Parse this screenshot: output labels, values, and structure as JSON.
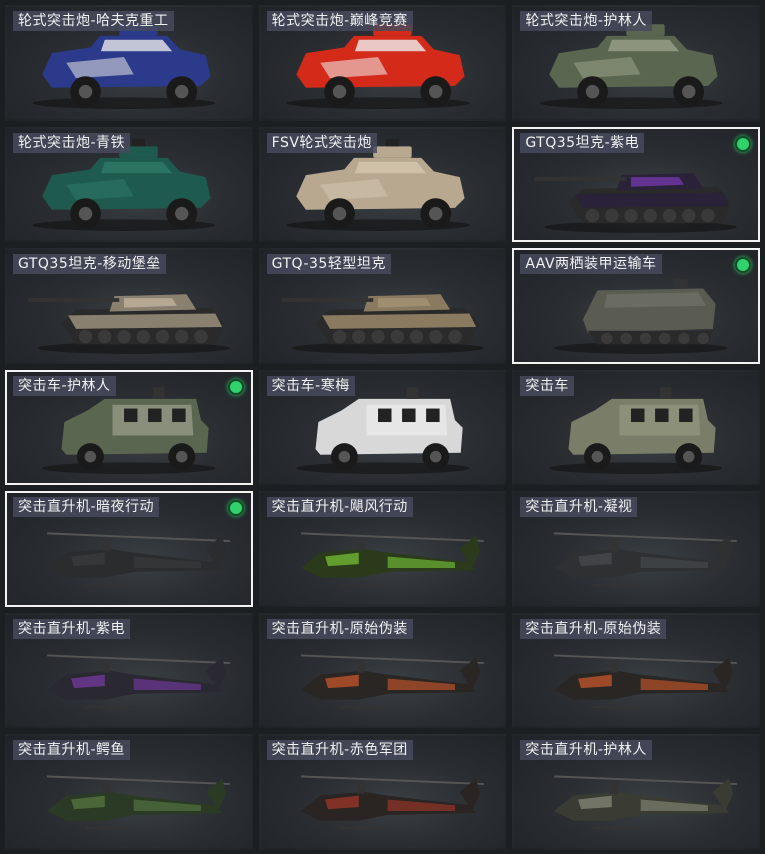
{
  "vehicles": [
    {
      "label": "轮式突击炮-哈夫克重工",
      "type": "wheeled",
      "camo": [
        "#2b3a8a",
        "#e8e8e8"
      ],
      "equipped": false
    },
    {
      "label": "轮式突击炮-巅峰竞赛",
      "type": "wheeled",
      "camo": [
        "#d32a1a",
        "#f0f0f0"
      ],
      "equipped": false
    },
    {
      "label": "轮式突击炮-护林人",
      "type": "wheeled",
      "camo": [
        "#5a6650",
        "#9aa088"
      ],
      "equipped": false
    },
    {
      "label": "轮式突击炮-青铁",
      "type": "wheeled",
      "camo": [
        "#1f5a4e",
        "#2e7a68"
      ],
      "equipped": false
    },
    {
      "label": "FSV轮式突击炮",
      "type": "wheeled",
      "camo": [
        "#b8a890",
        "#d4c6ae"
      ],
      "equipped": false
    },
    {
      "label": "GTQ35坦克-紫电",
      "type": "tank",
      "camo": [
        "#2a2238",
        "#7a3ab8"
      ],
      "equipped": true
    },
    {
      "label": "GTQ35坦克-移动堡垒",
      "type": "tank",
      "camo": [
        "#8a8070",
        "#c8b8a0"
      ],
      "equipped": false
    },
    {
      "label": "GTQ-35轻型坦克",
      "type": "tank",
      "camo": [
        "#8a7a60",
        "#a89878"
      ],
      "equipped": false
    },
    {
      "label": "AAV两栖装甲运输车",
      "type": "aav",
      "camo": [
        "#5a5c52",
        "#727468"
      ],
      "equipped": true
    },
    {
      "label": "突击车-护林人",
      "type": "truck",
      "camo": [
        "#5a6650",
        "#a8aa98"
      ],
      "equipped": true
    },
    {
      "label": "突击车-寒梅",
      "type": "truck",
      "camo": [
        "#d8d8d8",
        "#f0f0f0"
      ],
      "equipped": false
    },
    {
      "label": "突击车",
      "type": "truck",
      "camo": [
        "#7a7e68",
        "#9a9c86"
      ],
      "equipped": false
    },
    {
      "label": "突击直升机-暗夜行动",
      "type": "heli",
      "camo": [
        "#2a2c2e",
        "#3a3c3e"
      ],
      "equipped": true
    },
    {
      "label": "突击直升机-飓风行动",
      "type": "heli",
      "camo": [
        "#2a3a1a",
        "#7ac83a"
      ],
      "equipped": false
    },
    {
      "label": "突击直升机-凝视",
      "type": "heli",
      "camo": [
        "#2e3032",
        "#4a4c4e"
      ],
      "equipped": false
    },
    {
      "label": "突击直升机-紫电",
      "type": "heli",
      "camo": [
        "#2a2830",
        "#7a3aa8"
      ],
      "equipped": false
    },
    {
      "label": "突击直升机-原始伪装",
      "type": "heli",
      "camo": [
        "#2a2624",
        "#d0582a"
      ],
      "equipped": false
    },
    {
      "label": "突击直升机-原始伪装",
      "type": "heli",
      "camo": [
        "#2a2624",
        "#d0582a"
      ],
      "equipped": false
    },
    {
      "label": "突击直升机-鳄鱼",
      "type": "heli",
      "camo": [
        "#2a3a24",
        "#5a7a44"
      ],
      "equipped": false
    },
    {
      "label": "突击直升机-赤色军团",
      "type": "heli",
      "camo": [
        "#2a2422",
        "#a8382a"
      ],
      "equipped": false
    },
    {
      "label": "突击直升机-护林人",
      "type": "heli",
      "camo": [
        "#3a3c34",
        "#8a8c7a"
      ],
      "equipped": false
    }
  ]
}
